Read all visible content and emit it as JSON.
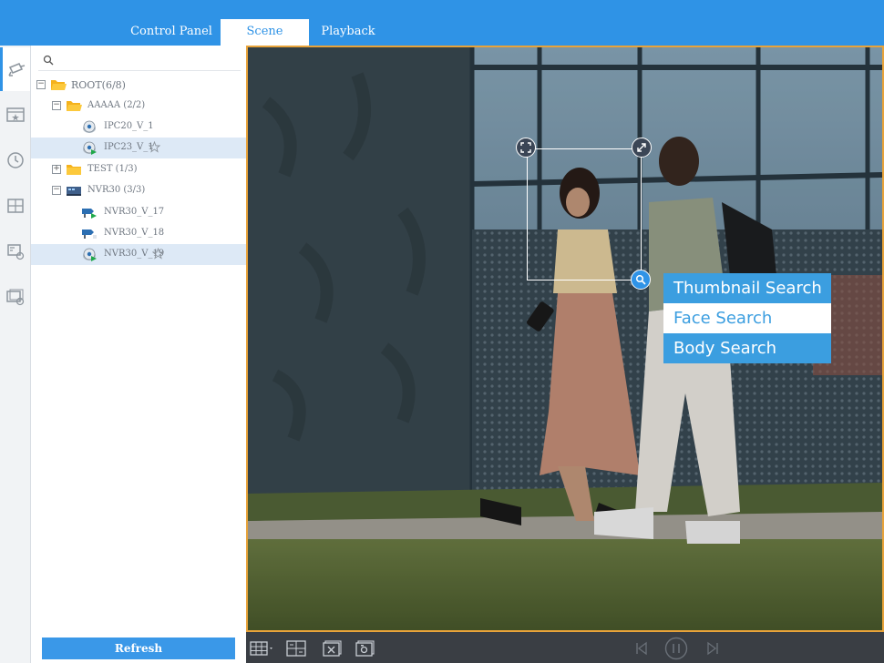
{
  "tabs": {
    "control_panel": "Control Panel",
    "scene": "Scene",
    "playback": "Playback"
  },
  "search": {
    "placeholder": ""
  },
  "tree": {
    "root": "ROOT(6/8)",
    "group_a": "AAAAA (2/2)",
    "ipc20": "IPC20_V_1",
    "ipc23": "IPC23_V_1",
    "test": "TEST (1/3)",
    "nvr30": "NVR30 (3/3)",
    "nvr30_17": "NVR30_V_17",
    "nvr30_18": "NVR30_V_18",
    "nvr30_19": "NVR30_V_19"
  },
  "refresh_label": "Refresh",
  "context_menu": {
    "thumbnail_search": "Thumbnail Search",
    "face_search": "Face Search",
    "body_search": "Body Search"
  },
  "colors": {
    "accent": "#2f93e6",
    "video_border": "#e8a33a",
    "menu_bg": "#3b9ee0"
  }
}
